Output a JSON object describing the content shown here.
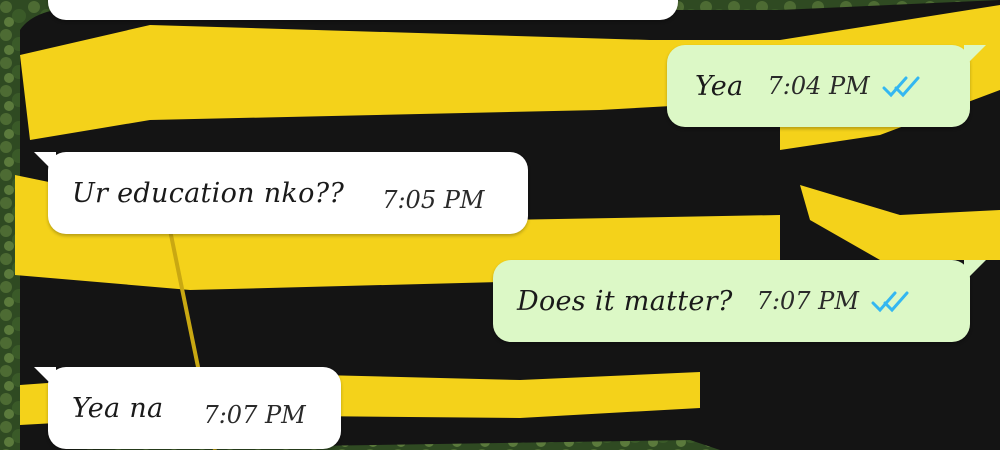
{
  "chat": {
    "messages": [
      {
        "direction": "outgoing",
        "text": "Yea",
        "time": "7:04 PM",
        "status": "read"
      },
      {
        "direction": "incoming",
        "text": "Ur education nko??",
        "time": "7:05 PM"
      },
      {
        "direction": "outgoing",
        "text": "Does it matter?",
        "time": "7:07 PM",
        "status": "read"
      },
      {
        "direction": "incoming",
        "text": "Yea na",
        "time": "7:07 PM"
      }
    ]
  },
  "colors": {
    "incoming_bubble": "#ffffff",
    "outgoing_bubble": "#dcf8c6",
    "read_ticks": "#34b7f1",
    "wallpaper_yellow": "#f4d21a",
    "wallpaper_black": "#141414",
    "wallpaper_green": "#3f5a2a"
  },
  "icons": {
    "read_status": "double-check-icon"
  }
}
